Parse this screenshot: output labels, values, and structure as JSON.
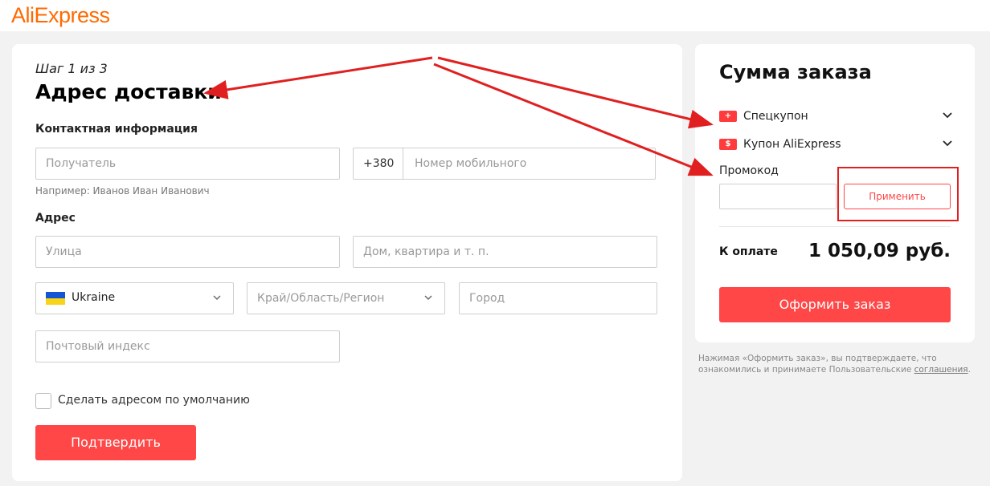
{
  "logo": "AliExpress",
  "form": {
    "step": "Шаг 1 из 3",
    "title": "Адрес доставки",
    "contact_section": "Контактная информация",
    "recipient_placeholder": "Получатель",
    "phone_prefix": "+380",
    "phone_placeholder": "Номер мобильного",
    "recipient_hint": "Например: Иванов Иван Иванович",
    "address_section": "Адрес",
    "street_placeholder": "Улица",
    "house_placeholder": "Дом, квартира и т. п.",
    "country_value": "Ukraine",
    "region_placeholder": "Край/Область/Регион",
    "city_placeholder": "Город",
    "postal_placeholder": "Почтовый индекс",
    "default_checkbox_label": "Сделать адресом по умолчанию",
    "confirm_label": "Подтвердить"
  },
  "summary": {
    "title": "Сумма заказа",
    "special_coupon": "Спецкупон",
    "aliexpress_coupon": "Купон AliExpress",
    "promo_label": "Промокод",
    "apply_label": "Применить",
    "to_pay_label": "К оплате",
    "amount": "1 050,09 руб.",
    "checkout_label": "Оформить заказ",
    "legal_text": "Нажимая «Оформить заказ», вы подтверждаете, что ознакомились и принимаете Пользовательские ",
    "legal_link": "соглашения",
    "legal_end": "."
  },
  "colors": {
    "brand": "#ff6a00",
    "accent": "#ff4747",
    "annotation": "#e02020"
  },
  "icons": {
    "coupon_special": "+",
    "coupon_aliexpress": "$"
  }
}
